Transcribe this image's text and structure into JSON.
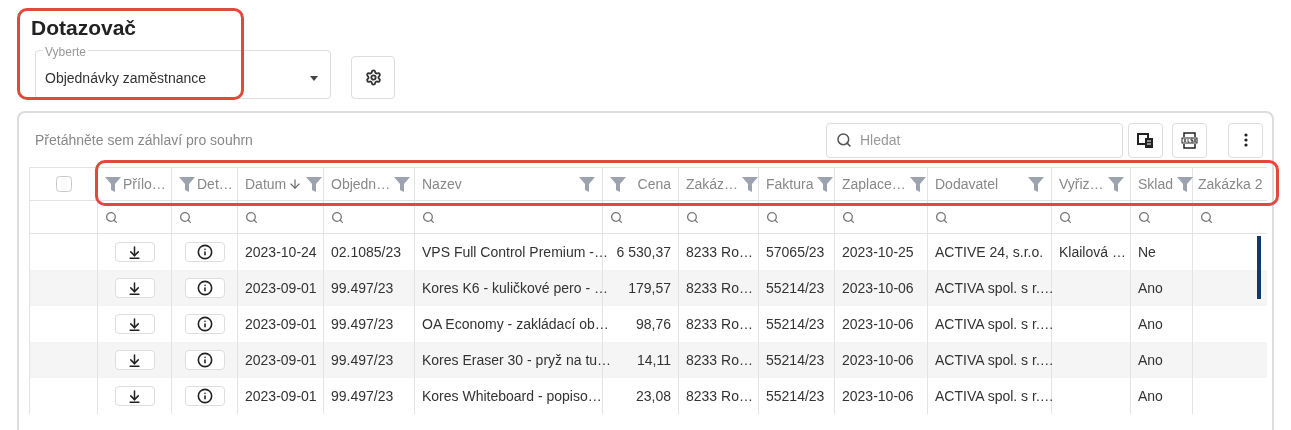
{
  "title": "Dotazovač",
  "select": {
    "label": "Vyberte",
    "value": "Objednávky zaměstnance"
  },
  "toolbar": {
    "group_panel": "Přetáhněte sem záhlaví pro souhrn",
    "search": {
      "placeholder": "Hledat"
    }
  },
  "table": {
    "select_all": {
      "checked": false
    },
    "columns": [
      {
        "label": "Přílo…",
        "kind": "download",
        "right_aligned": false,
        "filter_left": true,
        "filter_right": false,
        "sorted": false
      },
      {
        "label": "Det…",
        "kind": "info",
        "right_aligned": false,
        "filter_left": true,
        "filter_right": false,
        "sorted": false
      },
      {
        "label": "Datum",
        "kind": "text",
        "right_aligned": false,
        "filter_left": false,
        "filter_right": true,
        "sorted": true
      },
      {
        "label": "Objedn…",
        "kind": "text",
        "right_aligned": false,
        "filter_left": false,
        "filter_right": true,
        "sorted": false
      },
      {
        "label": "Nazev",
        "kind": "text",
        "right_aligned": false,
        "filter_left": false,
        "filter_right": true,
        "sorted": false
      },
      {
        "label": "Cena",
        "kind": "text",
        "right_aligned": true,
        "filter_left": true,
        "filter_right": false,
        "sorted": false
      },
      {
        "label": "Zakáz…",
        "kind": "text",
        "right_aligned": false,
        "filter_left": false,
        "filter_right": true,
        "sorted": false
      },
      {
        "label": "Faktura",
        "kind": "text",
        "right_aligned": false,
        "filter_left": false,
        "filter_right": true,
        "sorted": false
      },
      {
        "label": "Zaplace…",
        "kind": "text",
        "right_aligned": false,
        "filter_left": false,
        "filter_right": true,
        "sorted": false
      },
      {
        "label": "Dodavatel",
        "kind": "text",
        "right_aligned": false,
        "filter_left": false,
        "filter_right": true,
        "sorted": false
      },
      {
        "label": "Vyřiz…",
        "kind": "text",
        "right_aligned": false,
        "filter_left": false,
        "filter_right": true,
        "sorted": false
      },
      {
        "label": "Sklad",
        "kind": "text",
        "right_aligned": false,
        "filter_left": false,
        "filter_right": true,
        "sorted": false
      },
      {
        "label": "Zakázka 2",
        "kind": "text",
        "right_aligned": false,
        "filter_left": false,
        "filter_right": false,
        "sorted": false
      }
    ],
    "rows": [
      {
        "cells": [
          "",
          "",
          "2023-10-24",
          "02.1085/23",
          "VPS Full Control Premium -…",
          "6 530,37",
          "8233 Ro…",
          "57065/23",
          "2023-10-25",
          "ACTIVE 24, s.r.o.",
          "Klailová …",
          "Ne",
          ""
        ]
      },
      {
        "cells": [
          "",
          "",
          "2023-09-01",
          "99.497/23",
          "Kores K6 - kuličkové pero - …",
          "179,57",
          "8233 Ro…",
          "55214/23",
          "2023-10-06",
          "ACTIVA spol. s r.…",
          "",
          "Ano",
          ""
        ]
      },
      {
        "cells": [
          "",
          "",
          "2023-09-01",
          "99.497/23",
          "OA Economy - zakládací ob…",
          "98,76",
          "8233 Ro…",
          "55214/23",
          "2023-10-06",
          "ACTIVA spol. s r.…",
          "",
          "Ano",
          ""
        ]
      },
      {
        "cells": [
          "",
          "",
          "2023-09-01",
          "99.497/23",
          "Kores Eraser 30 - pryž na tu…",
          "14,11",
          "8233 Ro…",
          "55214/23",
          "2023-10-06",
          "ACTIVA spol. s r.…",
          "",
          "Ano",
          ""
        ]
      },
      {
        "cells": [
          "",
          "",
          "2023-09-01",
          "99.497/23",
          "Kores Whiteboard - popiso…",
          "23,08",
          "8233 Ro…",
          "55214/23",
          "2023-10-06",
          "ACTIVA spol. s r.…",
          "",
          "Ano",
          ""
        ]
      }
    ]
  }
}
